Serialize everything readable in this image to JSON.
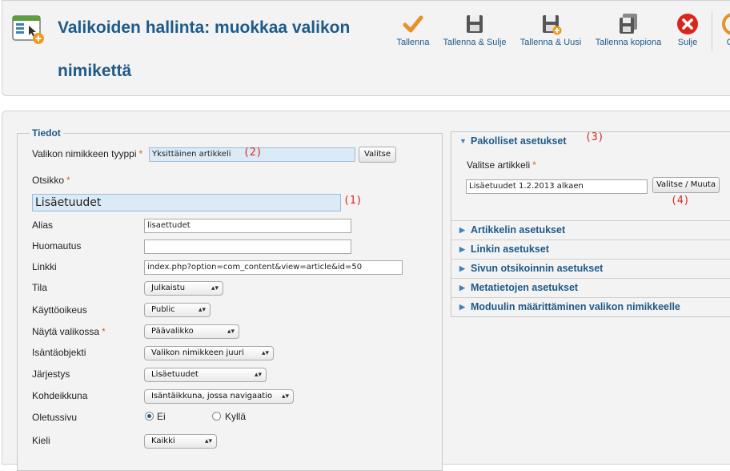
{
  "header": {
    "title": "Valikoiden hallinta: muokkaa valikon nimikettä",
    "toolbar": [
      {
        "label": "Tallenna",
        "icon": "checkmark-icon"
      },
      {
        "label": "Tallenna & Sulje",
        "icon": "save-icon"
      },
      {
        "label": "Tallenna & Uusi",
        "icon": "save-new-icon"
      },
      {
        "label": "Tallenna kopiona",
        "icon": "save-copy-icon"
      },
      {
        "label": "Sulje",
        "icon": "close-icon"
      },
      {
        "label": "O",
        "icon": "options-icon"
      }
    ]
  },
  "details": {
    "legend": "Tiedot",
    "type_label": "Valikon nimikkeen tyyppi",
    "type_value": "Yksittäinen artikkeli",
    "select_button": "Valitse",
    "title_label": "Otsikko",
    "title_value": "Lisäetuudet",
    "alias_label": "Alias",
    "alias_value": "lisaettudet",
    "note_label": "Huomautus",
    "note_value": "",
    "link_label": "Linkki",
    "link_value": "index.php?option=com_content&view=article&id=50",
    "status_label": "Tila",
    "status_value": "Julkaistu",
    "access_label": "Käyttöoikeus",
    "access_value": "Public",
    "menu_label": "Näytä valikossa",
    "menu_value": "Päävalikko",
    "parent_label": "Isäntäobjekti",
    "parent_value": "Valikon nimikkeen juuri",
    "order_label": "Järjestys",
    "order_value": "Lisäetuudet",
    "target_label": "Kohdeikkuna",
    "target_value": "Isäntäikkuna, jossa navigaatio",
    "default_label": "Oletussivu",
    "default_no": "Ei",
    "default_yes": "Kyllä",
    "language_label": "Kieli",
    "language_value": "Kaikki",
    "required_mark": "*"
  },
  "annotations": {
    "a1": "(1)",
    "a2": "(2)",
    "a3": "(3)",
    "a4": "(4)"
  },
  "right": {
    "required_title": "Pakolliset asetukset",
    "article_label": "Valitse artikkeli",
    "article_value": "Lisäetuudet 1.2.2013 alkaen",
    "change_button": "Valitse / Muuta",
    "sections": [
      "Artikkelin asetukset",
      "Linkin asetukset",
      "Sivun otsikoinnin asetukset",
      "Metatietojen asetukset",
      "Moduulin määrittäminen valikon nimikkeelle"
    ]
  },
  "colors": {
    "accent": "#1e5a8a",
    "required": "#e06020",
    "annotation": "#d9261c",
    "close": "#d9261c",
    "save": "#555555",
    "check": "#e8902a"
  }
}
